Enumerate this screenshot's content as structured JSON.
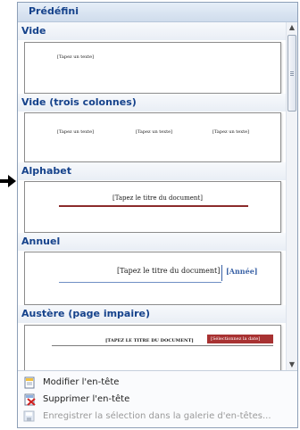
{
  "panel": {
    "title": "Prédéfini"
  },
  "gallery": {
    "categories": [
      {
        "label": "Vide",
        "placeholders": [
          "[Tapez un texte]"
        ]
      },
      {
        "label": "Vide (trois colonnes)",
        "placeholders": [
          "[Tapez un texte]",
          "[Tapez un texte]",
          "[Tapez un texte]"
        ]
      },
      {
        "label": "Alphabet",
        "placeholders": [
          "[Tapez le titre du document]"
        ]
      },
      {
        "label": "Annuel",
        "placeholders": [
          "[Tapez le titre du document]",
          "[Année]"
        ]
      },
      {
        "label": "Austère (page impaire)",
        "placeholders": [
          "[TAPEZ LE TITRE DU DOCUMENT]",
          "[Sélectionnez la date]"
        ]
      }
    ]
  },
  "menu": {
    "items": [
      {
        "label": "Modifier l'en-tête",
        "enabled": true
      },
      {
        "label": "Supprimer l'en-tête",
        "enabled": true
      },
      {
        "label": "Enregistrer la sélection dans la galerie d'en-têtes...",
        "enabled": false
      }
    ]
  },
  "colors": {
    "accent": "#15428b",
    "alphabet_rule": "#8b2b2b",
    "annual_accent": "#3a62a6",
    "austere_date_bg": "#a83232"
  }
}
